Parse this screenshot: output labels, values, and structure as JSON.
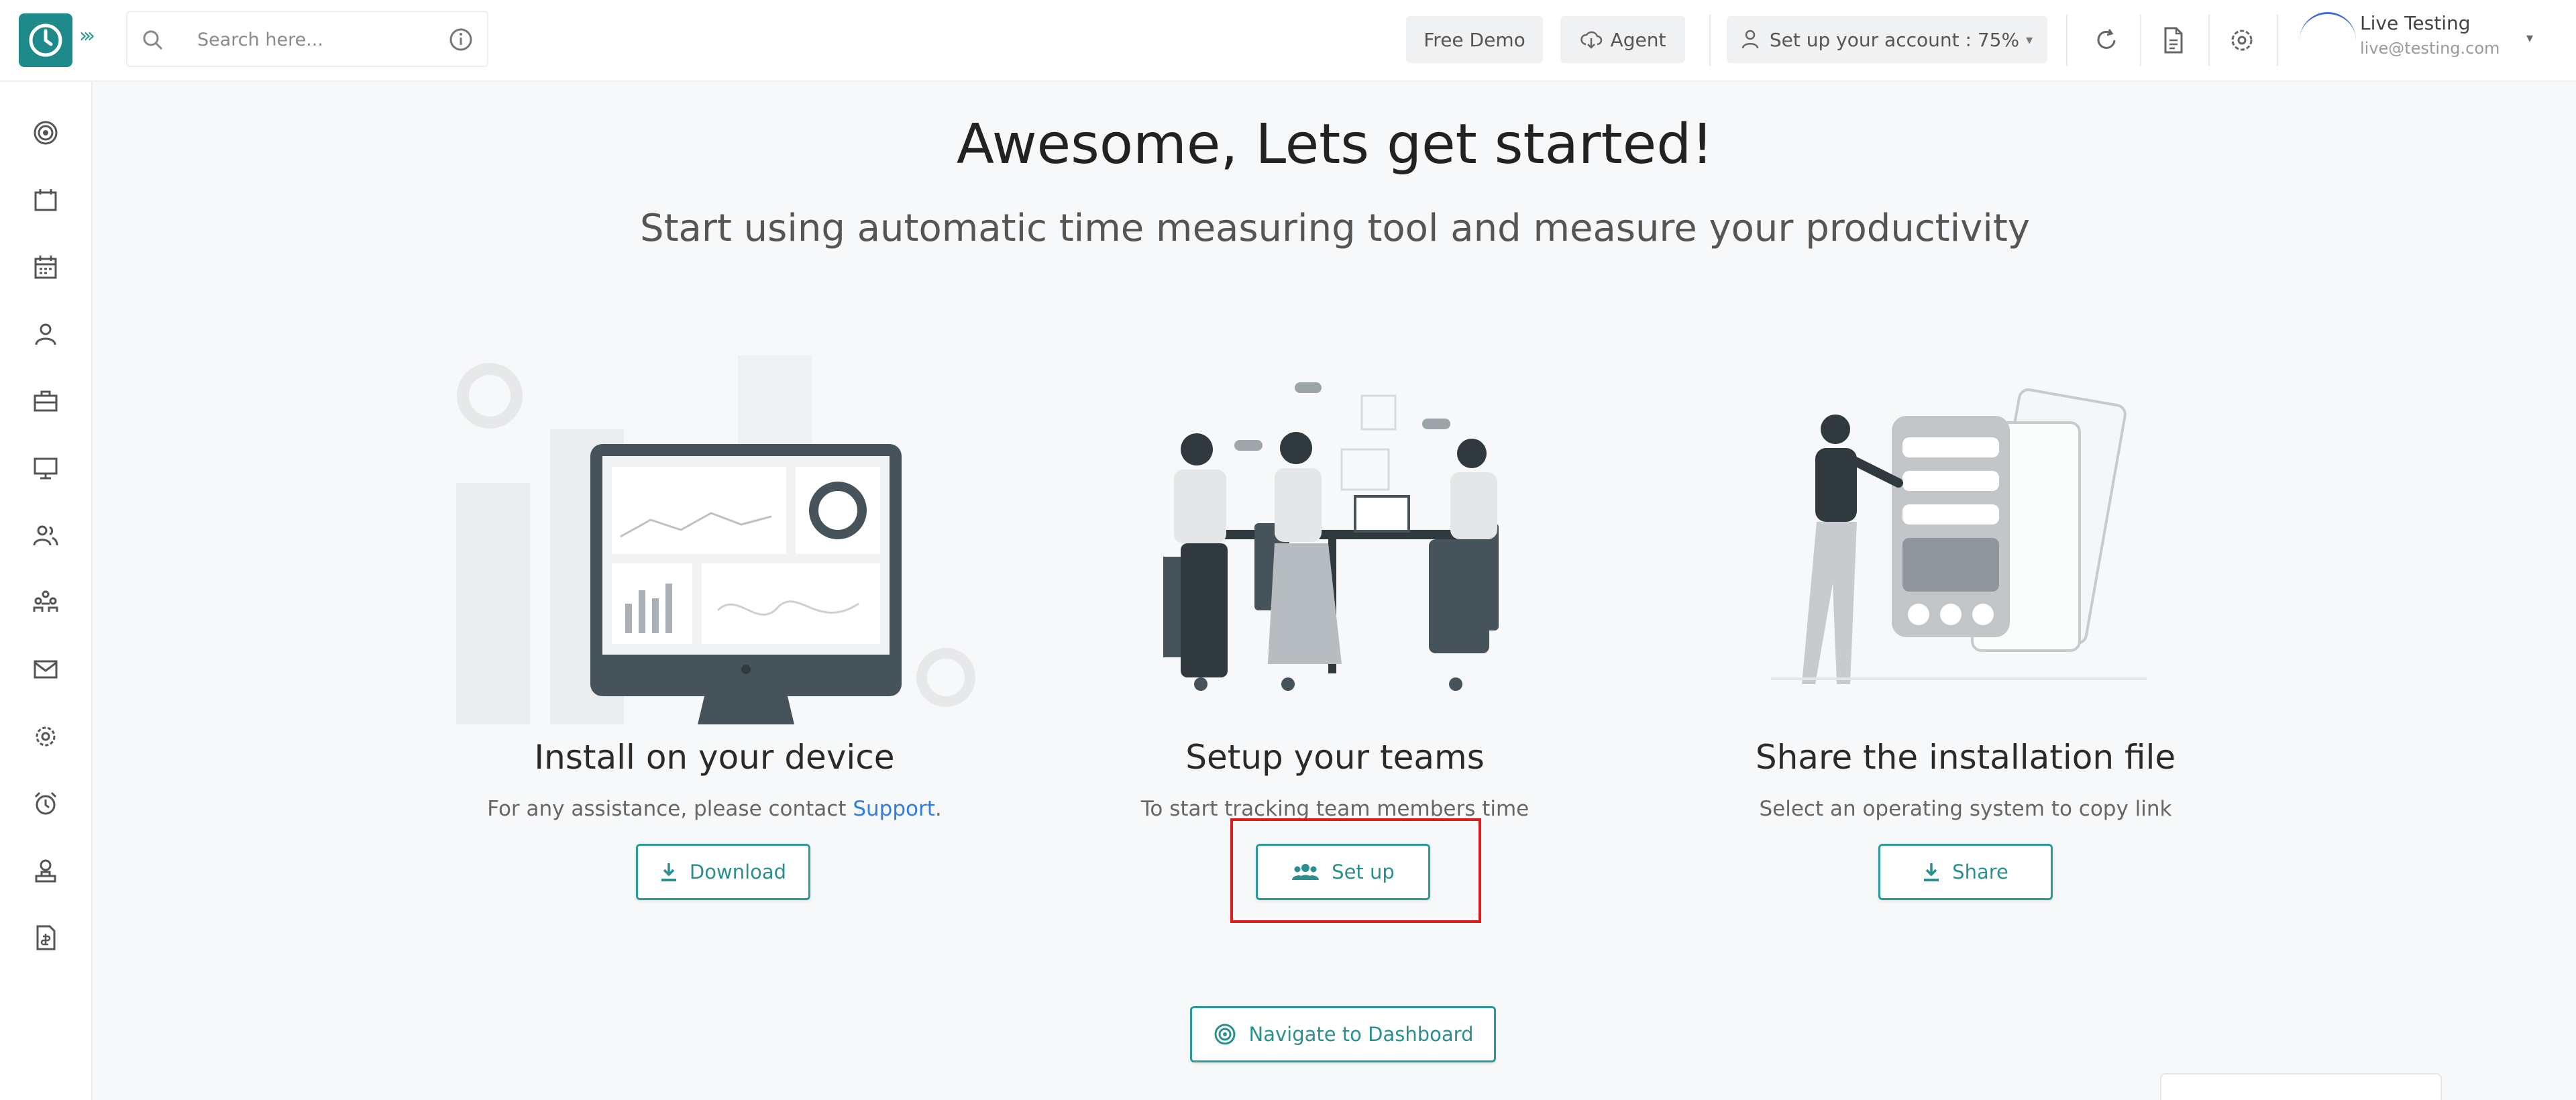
{
  "header": {
    "search_placeholder": "Search here...",
    "free_demo_label": "Free Demo",
    "agent_label": "Agent",
    "setup_account_label": "Set up your account : 75%",
    "user": {
      "name": "Live Testing",
      "email": "live@testing.com"
    }
  },
  "sidebar": {
    "items": [
      {
        "icon": "dashboard-icon"
      },
      {
        "icon": "calendar-icon"
      },
      {
        "icon": "schedule-icon"
      },
      {
        "icon": "user-icon"
      },
      {
        "icon": "briefcase-icon"
      },
      {
        "icon": "monitor-icon"
      },
      {
        "icon": "users-icon"
      },
      {
        "icon": "team-icon"
      },
      {
        "icon": "mail-icon"
      },
      {
        "icon": "settings-icon"
      },
      {
        "icon": "alarm-icon"
      },
      {
        "icon": "agent-icon"
      },
      {
        "icon": "report-icon"
      }
    ]
  },
  "main": {
    "title": "Awesome, Lets get started!",
    "subtitle": "Start using automatic time measuring tool and measure your productivity",
    "cards": [
      {
        "title": "Install on your device",
        "description_prefix": "For any assistance, please contact ",
        "link": "Support",
        "description_suffix": ".",
        "button": "Download"
      },
      {
        "title": "Setup your teams",
        "description": "To start tracking team members time",
        "button": "Set up"
      },
      {
        "title": "Share the installation file",
        "description": "Select an operating system to copy link",
        "button": "Share"
      }
    ],
    "dashboard_button": "Navigate to Dashboard"
  },
  "colors": {
    "brand": "#1e8a8a",
    "accent": "#2a9a9a",
    "highlight": "#e0191b",
    "link": "#2f7de1"
  }
}
